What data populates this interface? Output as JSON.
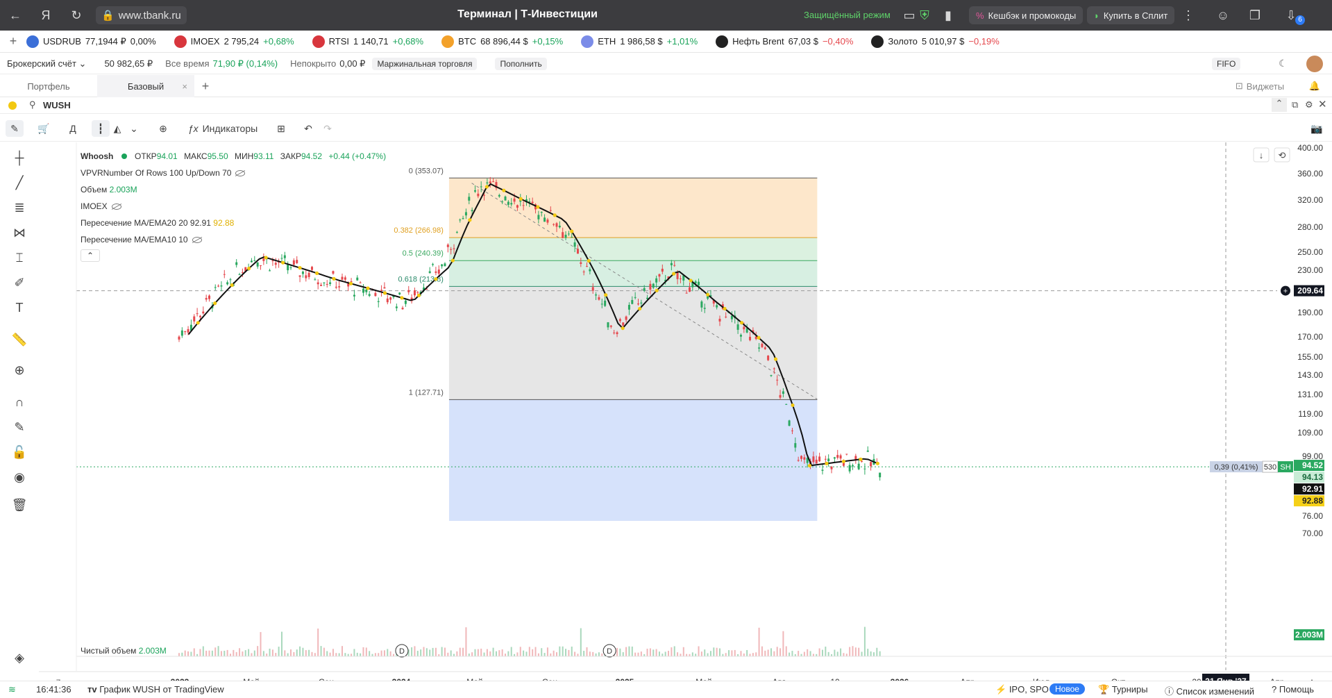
{
  "browser": {
    "url": "www.tbank.ru",
    "title": "Терминал | Т-Инвестиции",
    "secure_mode": "Защищённый режим",
    "cashback": "Кешбэк и промокоды",
    "split": "Купить в Сплит",
    "badge": "6"
  },
  "tickers": [
    {
      "name": "USDRUB",
      "price": "77,1944 ₽",
      "change": "0,00%",
      "dir": "neutral",
      "color": "#3b6fd8"
    },
    {
      "name": "IMOEX",
      "price": "2 795,24",
      "change": "+0,68%",
      "dir": "pos",
      "color": "#d8363d"
    },
    {
      "name": "RTSI",
      "price": "1 140,71",
      "change": "+0,68%",
      "dir": "pos",
      "color": "#d8363d"
    },
    {
      "name": "BTC",
      "price": "68 896,44 $",
      "change": "+0,15%",
      "dir": "pos",
      "color": "#f3a12a"
    },
    {
      "name": "ETH",
      "price": "1 986,58 $",
      "change": "+1,01%",
      "dir": "pos",
      "color": "#7b8ce8"
    },
    {
      "name": "Нефть Brent",
      "price": "67,03 $",
      "change": "−0,40%",
      "dir": "neg",
      "color": "#222"
    },
    {
      "name": "Золото",
      "price": "5 010,97 $",
      "change": "−0,19%",
      "dir": "neg",
      "color": "#222"
    }
  ],
  "account": {
    "type": "Брокерский счёт",
    "balance": "50 982,65 ₽",
    "alltime_label": "Все время",
    "alltime_value": "71,90 ₽ (0,14%)",
    "uncovered_label": "Непокрыто",
    "uncovered_value": "0,00 ₽",
    "margin": "Маржинальная торговля",
    "topup": "Пополнить",
    "fifo": "FIFO"
  },
  "tabs": {
    "portfolio": "Портфель",
    "base": "Базовый",
    "widgets": "Виджеты"
  },
  "search": {
    "ticker": "WUSH"
  },
  "toolbar": {
    "period": "Д",
    "indicators": "Индикаторы"
  },
  "legend": {
    "name": "Whoosh",
    "open_label": "ОТКР",
    "open": "94.01",
    "high_label": "МАКС",
    "high": "95.50",
    "low_label": "МИН",
    "low": "93.11",
    "close_label": "ЗАКР",
    "close": "94.52",
    "change": "+0.44 (+0.47%)",
    "vpvr": "VPVRNumber Of Rows 100 Up/Down 70",
    "volume_label": "Объем",
    "volume": "2.003M",
    "imoex": "IMOEX",
    "ma20_label": "Пересечение MA/EMA20 20",
    "ma20_a": "92.91",
    "ma20_b": "92.88",
    "ma10_label": "Пересечение MA/EMA10 10",
    "net_volume_label": "Чистый объем",
    "net_volume": "2.003M"
  },
  "fib": [
    {
      "label": "0 (353.07)",
      "price": 353.07,
      "color": "#555"
    },
    {
      "label": "0.382 (266.98)",
      "price": 266.98,
      "color": "#e0a020"
    },
    {
      "label": "0.5 (240.39)",
      "price": 240.39,
      "color": "#3aa860"
    },
    {
      "label": "0.618 (213.8)",
      "price": 213.8,
      "color": "#2a8a6a"
    },
    {
      "label": "1 (127.71)",
      "price": 127.71,
      "color": "#555"
    }
  ],
  "yaxis": [
    "400.00",
    "360.00",
    "320.00",
    "280.00",
    "250.00",
    "230.00",
    "190.00",
    "170.00",
    "155.00",
    "143.00",
    "131.00",
    "119.00",
    "109.00",
    "99.00",
    "76.00",
    "70.00"
  ],
  "price_tags": {
    "crosshair": "209.64",
    "last": "94.52",
    "t2": "94.13",
    "ma_a": "92.91",
    "ma_b": "92.88",
    "vol": "2.003M",
    "pos_change": "0,39 (0,41%)",
    "pos_qty": "530",
    "pos_sh": "SH"
  },
  "xaxis": [
    {
      "label": "2023",
      "bold": true
    },
    {
      "label": "Май",
      "bold": false
    },
    {
      "label": "Сен",
      "bold": false
    },
    {
      "label": "2024",
      "bold": true
    },
    {
      "label": "Май",
      "bold": false
    },
    {
      "label": "Сен",
      "bold": false
    },
    {
      "label": "2025",
      "bold": true
    },
    {
      "label": "Май",
      "bold": false
    },
    {
      "label": "Авг",
      "bold": false
    },
    {
      "label": "10",
      "bold": false
    },
    {
      "label": "2026",
      "bold": true
    },
    {
      "label": "Апр",
      "bold": false
    },
    {
      "label": "Июл",
      "bold": false
    },
    {
      "label": "Окт",
      "bold": false
    },
    {
      "label": "20",
      "bold": false
    },
    {
      "label": "Апр",
      "bold": false
    }
  ],
  "xaxis_cursor": "31 Янв '27",
  "xaxis_z": "Z",
  "xaxis_a": "A",
  "status": {
    "time": "16:41:36",
    "chart_source": "График WUSH от TradingView",
    "ipo": "IPO, SPO",
    "new_badge": "Новое",
    "tournaments": "Турниры",
    "changelog": "Список изменений",
    "help": "Помощь"
  },
  "colors": {
    "up": "#2aa860",
    "down": "#e5484d",
    "ma": "#111111",
    "ema": "#f2c811",
    "fib_top": "#fde7cb",
    "fib_mid": "#dbf1e0",
    "fib_gray": "#e6e6e6",
    "fib_blue": "#d6e2fb"
  },
  "chart_data": {
    "type": "line",
    "title": "Whoosh",
    "x": [
      "2023-01",
      "2023-05",
      "2023-09",
      "2024-01",
      "2024-03",
      "2024-05",
      "2024-09",
      "2024-12",
      "2025-03",
      "2025-05",
      "2025-08",
      "2025-10",
      "2026-01",
      "2026-02"
    ],
    "series": [
      {
        "values": [
          170,
          245,
          220,
          200,
          235,
          345,
          290,
          175,
          230,
          200,
          160,
          95,
          98,
          94.52
        ]
      }
    ],
    "ylim": [
      70,
      400
    ]
  }
}
